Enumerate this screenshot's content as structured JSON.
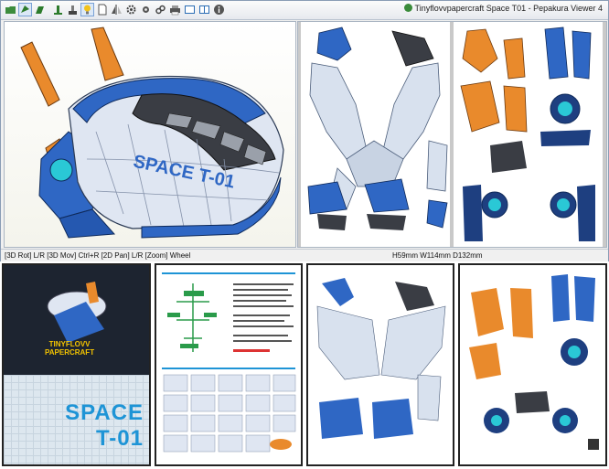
{
  "window": {
    "title": "Tinyflovvpapercraft Space T01 - Pepakura Viewer 4"
  },
  "toolbar": {
    "buttons": [
      {
        "icon": "open-folder-icon"
      },
      {
        "icon": "3d-view-icon",
        "active": true
      },
      {
        "icon": "unfold-icon"
      },
      {
        "icon": "fold-icon"
      },
      {
        "icon": "paint-icon"
      },
      {
        "icon": "lightbulb-icon",
        "active": true
      },
      {
        "icon": "document-icon"
      },
      {
        "icon": "flip-icon"
      },
      {
        "icon": "gear-icon"
      },
      {
        "icon": "link-icon"
      },
      {
        "icon": "print-icon"
      },
      {
        "icon": "single-pane-icon"
      },
      {
        "icon": "dual-pane-icon"
      },
      {
        "icon": "info-icon"
      }
    ]
  },
  "model": {
    "hull_text": "SPACE T-01"
  },
  "status": {
    "left": "[3D Rot] L/R [3D Mov] Ctrl+R [2D Pan] L/R [Zoom] Wheel",
    "right": "H59mm W114mm D132mm"
  },
  "thumbnails": {
    "cover": {
      "brand_line1": "TINYFLOVV",
      "brand_line2": "PAPERCRAFT",
      "title_line1": "SPACE",
      "title_line2": "T-01"
    }
  },
  "colors": {
    "hull_light": "#dfe6f2",
    "hull_blue": "#2f67c4",
    "hull_dark": "#3a3d44",
    "fin_orange": "#e98a2c",
    "accent_cyan": "#2ac8d6"
  }
}
